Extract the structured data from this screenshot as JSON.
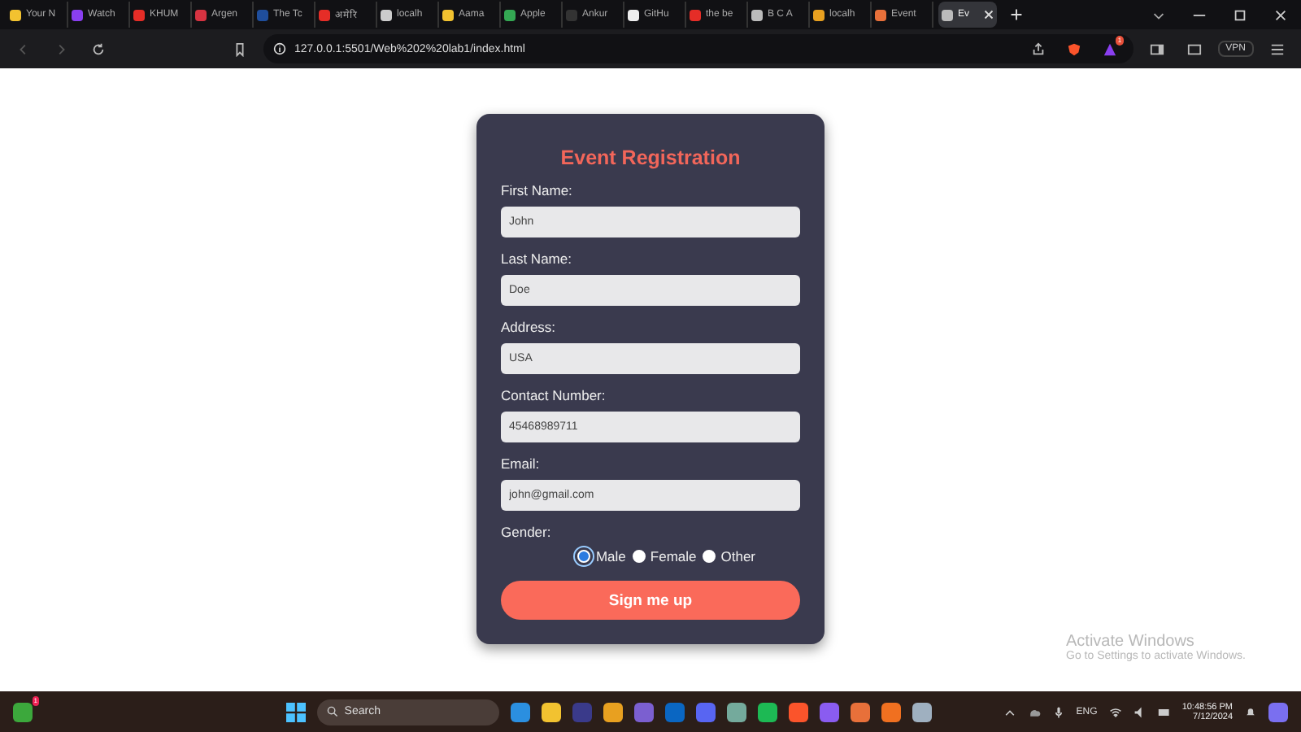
{
  "browser": {
    "tabs": [
      {
        "title": "Your N",
        "selected": false,
        "color": "#f2c230"
      },
      {
        "title": "Watch",
        "selected": false,
        "color": "#8a3ff0"
      },
      {
        "title": "KHUM",
        "selected": false,
        "color": "#e52d27"
      },
      {
        "title": "Argen",
        "selected": false,
        "color": "#d63341"
      },
      {
        "title": "The Tc",
        "selected": false,
        "color": "#1f4e9c"
      },
      {
        "title": "अमेरि",
        "selected": false,
        "color": "#e52d27"
      },
      {
        "title": "localh",
        "selected": false,
        "color": "#cccccc"
      },
      {
        "title": "Aama",
        "selected": false,
        "color": "#f2c230"
      },
      {
        "title": "Apple",
        "selected": false,
        "color": "#34a853"
      },
      {
        "title": "Ankur",
        "selected": false,
        "color": "#333333"
      },
      {
        "title": "GitHu",
        "selected": false,
        "color": "#eeeeee"
      },
      {
        "title": "the be",
        "selected": false,
        "color": "#e52d27"
      },
      {
        "title": "B C A",
        "selected": false,
        "color": "#bbbbbb"
      },
      {
        "title": "localh",
        "selected": false,
        "color": "#e8a020"
      },
      {
        "title": "Event",
        "selected": false,
        "color": "#e8703a"
      },
      {
        "title": "Ev",
        "selected": true,
        "color": "#bbbbbb"
      }
    ],
    "url": "127.0.0.1:5501/Web%202%20lab1/index.html",
    "vpn_label": "VPN",
    "alert_badge": "1"
  },
  "form": {
    "title": "Event Registration",
    "fields": [
      {
        "label": "First Name:",
        "value": "John"
      },
      {
        "label": "Last Name:",
        "value": "Doe"
      },
      {
        "label": "Address:",
        "value": "USA"
      },
      {
        "label": "Contact Number:",
        "value": "45468989711"
      },
      {
        "label": "Email:",
        "value": "john@gmail.com"
      }
    ],
    "gender_label": "Gender:",
    "genders": [
      {
        "label": "Male",
        "selected": true
      },
      {
        "label": "Female",
        "selected": false
      },
      {
        "label": "Other",
        "selected": false
      }
    ],
    "submit": "Sign me up"
  },
  "activation_notice": {
    "title": "Activate Windows",
    "subtitle": "Go to Settings to activate Windows."
  },
  "taskbar": {
    "widget_badge": "1",
    "search": "Search",
    "apps": [
      {
        "color": "#2b8fe0"
      },
      {
        "color": "#f2c230"
      },
      {
        "color": "#3a3a8a"
      },
      {
        "color": "#e8a020"
      },
      {
        "color": "#7b5fd0"
      },
      {
        "color": "#0a66c2"
      },
      {
        "color": "#5865f2"
      },
      {
        "color": "#74aa9c"
      },
      {
        "color": "#1db954"
      },
      {
        "color": "#fb542b"
      },
      {
        "color": "#8a5cf0"
      },
      {
        "color": "#e8703a"
      },
      {
        "color": "#f07020"
      },
      {
        "color": "#9fb0c0"
      }
    ],
    "language": "ENG",
    "time": "10:48:56 PM",
    "date": "7/12/2024"
  }
}
